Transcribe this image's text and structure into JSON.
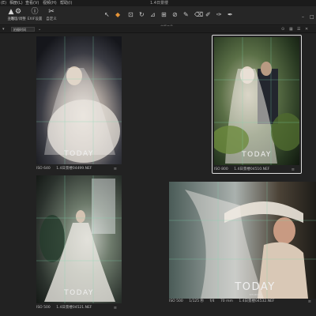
{
  "app_title": "1.4日景楼",
  "menu": [
    "(E)",
    "相册(L)",
    "查看(V)",
    "视频(H)",
    "帮助(I)"
  ],
  "toolbar": {
    "buttons": [
      {
        "icon": "▲",
        "label": "查看"
      },
      {
        "icon": "⚙",
        "label": "处理/调整"
      },
      {
        "icon": "ⓘ",
        "label": "EXIF设置"
      },
      {
        "icon": "✂",
        "label": "自定义"
      }
    ],
    "tools_label": "文版工具",
    "window_controls": [
      "–",
      "□"
    ]
  },
  "filterbar": {
    "sort_value": "拍摄时间",
    "right_icons": [
      "⊙",
      "▦",
      "☰",
      "✕"
    ]
  },
  "photos": [
    {
      "iso": "ISO 640",
      "filename": "1.4日景楼04499.NEF",
      "selected": false,
      "logo": "TODAY"
    },
    {
      "iso": "ISO 800",
      "filename": "1.4日景楼04510.NEF",
      "selected": true,
      "logo": "TODAY"
    },
    {
      "iso": "ISO 500",
      "filename": "1.4日景楼04521.NEF",
      "selected": false,
      "logo": "TODAY"
    },
    {
      "iso": "ISO 500",
      "shutter": "1/125 秒",
      "aperture": "f/4",
      "focal": "70 mm",
      "filename": "1.4日景楼04532.NEF",
      "selected": false,
      "logo": "TODAY",
      "logo_sub": "STUDIO"
    }
  ],
  "colors": {
    "background": "#222222",
    "toolbar": "#262626",
    "accent_orange": "#e59437",
    "grid_overlay": "#7fd6ae"
  }
}
